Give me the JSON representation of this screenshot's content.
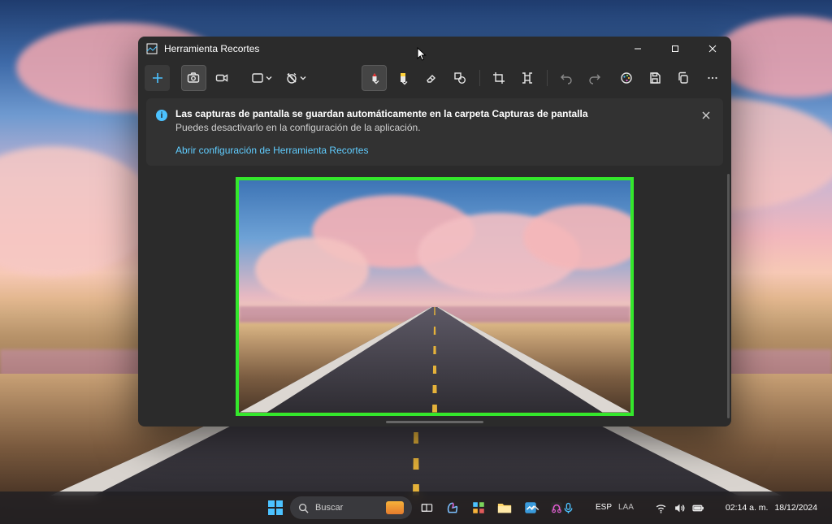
{
  "window": {
    "title": "Herramienta Recortes",
    "info": {
      "title": "Las capturas de pantalla se guardan automáticamente en la carpeta Capturas de pantalla",
      "subtitle": "Puedes desactivarlo en la configuración de la aplicación.",
      "link": "Abrir configuración de Herramienta Recortes"
    },
    "toolbar": {
      "new": "new-snip",
      "camera": "screenshot-mode",
      "video": "record-mode",
      "shape": "snip-shape",
      "delay": "snip-delay",
      "pen": "pen-tool",
      "highlighter": "highlighter-tool",
      "eraser": "eraser-tool",
      "shape2": "shapes-tool",
      "crop": "crop-tool",
      "textextract": "text-actions",
      "undo": "undo",
      "redo": "redo",
      "paint": "edit-in-paint",
      "save": "save",
      "copy": "copy",
      "more": "more"
    },
    "colors": {
      "pen": "#e12b2b",
      "highlighter": "#ffd23a"
    },
    "snap_border": "#34e72c"
  },
  "taskbar": {
    "search_placeholder": "Buscar",
    "lang_top": "ESP",
    "lang_bottom": "LAA",
    "time": "02:14 a. m.",
    "date": "18/12/2024"
  }
}
